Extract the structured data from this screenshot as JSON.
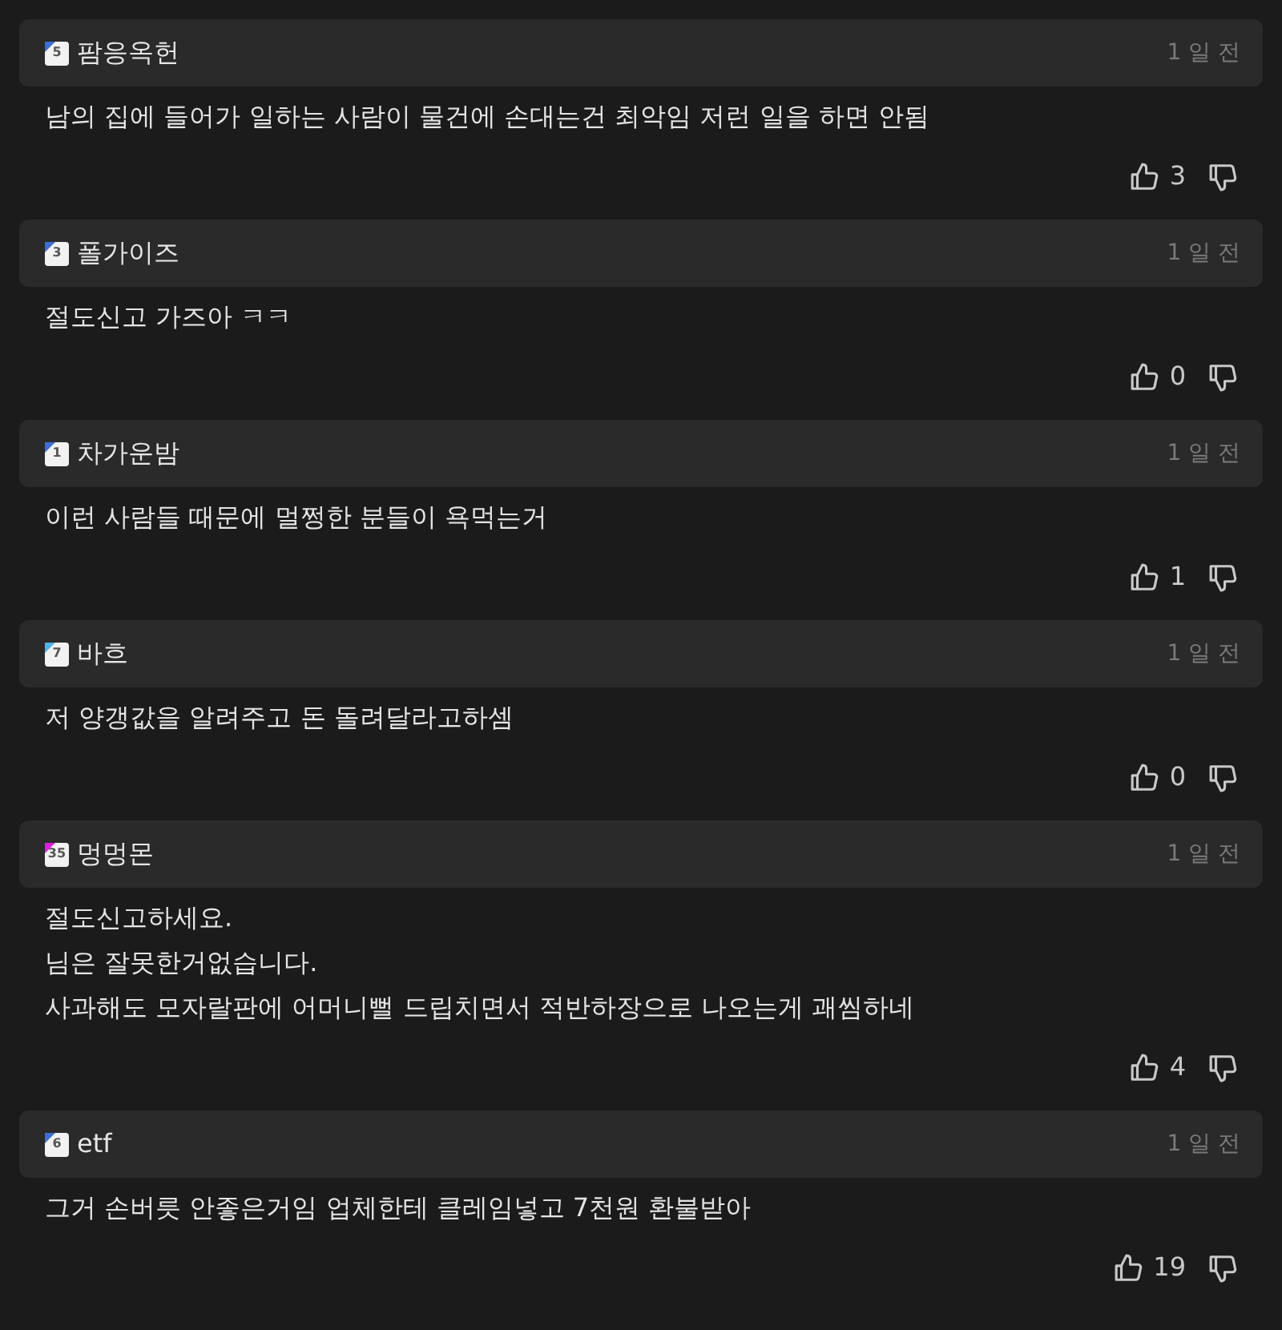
{
  "comments": [
    {
      "user": "팜응옥헌",
      "level": "5",
      "color": "#3b6fd6",
      "time": "1 일 전",
      "lines": [
        "남의 집에 들어가 일하는 사람이 물건에 손대는건 최악임 저런 일을 하면 안됨"
      ],
      "likes": "3"
    },
    {
      "user": "폴가이즈",
      "level": "3",
      "color": "#3b6fd6",
      "time": "1 일 전",
      "lines": [
        "절도신고 가즈아 ㅋㅋ"
      ],
      "likes": "0"
    },
    {
      "user": "차가운밤",
      "level": "1",
      "color": "#3b6fd6",
      "time": "1 일 전",
      "lines": [
        "이런 사람들 때문에 멀쩡한 분들이 욕먹는거"
      ],
      "likes": "1"
    },
    {
      "user": "바흐",
      "level": "7",
      "color": "#4fb3f0",
      "time": "1 일 전",
      "lines": [
        "저 양갱값을 알려주고 돈 돌려달라고하셈"
      ],
      "likes": "0"
    },
    {
      "user": "멍멍몬",
      "level": "35",
      "color": "#e01ee0",
      "time": "1 일 전",
      "lines": [
        "절도신고하세요.",
        "님은 잘못한거없습니다.",
        "사과해도 모자랄판에 어머니뻘 드립치면서 적반하장으로 나오는게 괘씸하네"
      ],
      "likes": "4"
    },
    {
      "user": "etf",
      "level": "6",
      "color": "#3b6fd6",
      "time": "1 일 전",
      "lines": [
        "그거 손버릇 안좋은거임 업체한테 클레임넣고 7천원 환불받아"
      ],
      "likes": "19"
    }
  ]
}
